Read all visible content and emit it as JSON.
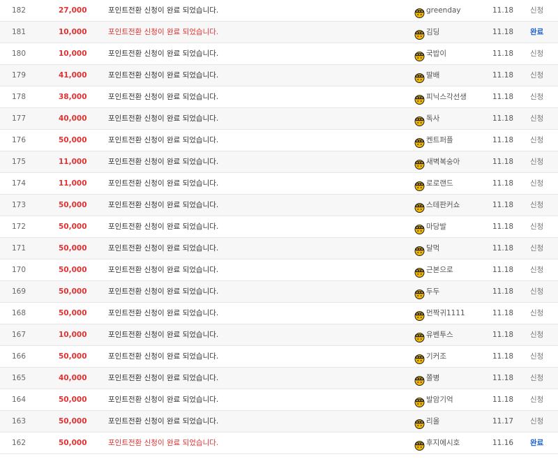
{
  "accent_red": "#e03131",
  "accent_blue": "#1a5fd0",
  "rows": [
    {
      "num": "182",
      "amount": "27,000",
      "subject": "포인트전환 신청이 완료 되었습니다.",
      "user": "greenday",
      "date": "11.18",
      "status": "신청",
      "done": false,
      "avatar_icon": "helmet-avatar-icon"
    },
    {
      "num": "181",
      "amount": "10,000",
      "subject": "포인트전환 신청이 완료 되었습니다.",
      "user": "김딩",
      "date": "11.18",
      "status": "완료",
      "done": true,
      "avatar_icon": "helmet-avatar-icon"
    },
    {
      "num": "180",
      "amount": "10,000",
      "subject": "포인트전환 신청이 완료 되었습니다.",
      "user": "국밥이",
      "date": "11.18",
      "status": "신청",
      "done": false,
      "avatar_icon": "helmet-avatar-icon"
    },
    {
      "num": "179",
      "amount": "41,000",
      "subject": "포인트전환 신청이 완료 되었습니다.",
      "user": "딸배",
      "date": "11.18",
      "status": "신청",
      "done": false,
      "avatar_icon": "helmet-avatar-icon"
    },
    {
      "num": "178",
      "amount": "38,000",
      "subject": "포인트전환 신청이 완료 되었습니다.",
      "user": "피닉스각선생",
      "date": "11.18",
      "status": "신청",
      "done": false,
      "avatar_icon": "helmet-avatar-icon"
    },
    {
      "num": "177",
      "amount": "40,000",
      "subject": "포인트전환 신청이 완료 되었습니다.",
      "user": "독사",
      "date": "11.18",
      "status": "신청",
      "done": false,
      "avatar_icon": "helmet-avatar-icon"
    },
    {
      "num": "176",
      "amount": "50,000",
      "subject": "포인트전환 신청이 완료 되었습니다.",
      "user": "켄트퍼플",
      "date": "11.18",
      "status": "신청",
      "done": false,
      "avatar_icon": "helmet-avatar-icon"
    },
    {
      "num": "175",
      "amount": "11,000",
      "subject": "포인트전환 신청이 완료 되었습니다.",
      "user": "새벽복숭아",
      "date": "11.18",
      "status": "신청",
      "done": false,
      "avatar_icon": "helmet-avatar-icon"
    },
    {
      "num": "174",
      "amount": "11,000",
      "subject": "포인트전환 신청이 완료 되었습니다.",
      "user": "로로랜드",
      "date": "11.18",
      "status": "신청",
      "done": false,
      "avatar_icon": "helmet-avatar-icon"
    },
    {
      "num": "173",
      "amount": "50,000",
      "subject": "포인트전환 신청이 완료 되었습니다.",
      "user": "스테판커쇼",
      "date": "11.18",
      "status": "신청",
      "done": false,
      "avatar_icon": "helmet-avatar-icon"
    },
    {
      "num": "172",
      "amount": "50,000",
      "subject": "포인트전환 신청이 완료 되었습니다.",
      "user": "마당발",
      "date": "11.18",
      "status": "신청",
      "done": false,
      "avatar_icon": "helmet-avatar-icon"
    },
    {
      "num": "171",
      "amount": "50,000",
      "subject": "포인트전환 신청이 완료 되었습니다.",
      "user": "달먹",
      "date": "11.18",
      "status": "신청",
      "done": false,
      "avatar_icon": "helmet-avatar-icon"
    },
    {
      "num": "170",
      "amount": "50,000",
      "subject": "포인트전환 신청이 완료 되었습니다.",
      "user": "근본으로",
      "date": "11.18",
      "status": "신청",
      "done": false,
      "avatar_icon": "helmet-avatar-icon"
    },
    {
      "num": "169",
      "amount": "50,000",
      "subject": "포인트전환 신청이 완료 되었습니다.",
      "user": "두두",
      "date": "11.18",
      "status": "신청",
      "done": false,
      "avatar_icon": "helmet-avatar-icon"
    },
    {
      "num": "168",
      "amount": "50,000",
      "subject": "포인트전환 신청이 완료 되었습니다.",
      "user": "먼짝귀1111",
      "date": "11.18",
      "status": "신청",
      "done": false,
      "avatar_icon": "helmet-avatar-icon"
    },
    {
      "num": "167",
      "amount": "10,000",
      "subject": "포인트전환 신청이 완료 되었습니다.",
      "user": "유벤투스",
      "date": "11.18",
      "status": "신청",
      "done": false,
      "avatar_icon": "helmet-avatar-icon"
    },
    {
      "num": "166",
      "amount": "50,000",
      "subject": "포인트전환 신청이 완료 되었습니다.",
      "user": "기커조",
      "date": "11.18",
      "status": "신청",
      "done": false,
      "avatar_icon": "helmet-avatar-icon"
    },
    {
      "num": "165",
      "amount": "40,000",
      "subject": "포인트전환 신청이 완료 되었습니다.",
      "user": "쫄병",
      "date": "11.18",
      "status": "신청",
      "done": false,
      "avatar_icon": "helmet-avatar-icon"
    },
    {
      "num": "164",
      "amount": "50,000",
      "subject": "포인트전환 신청이 완료 되었습니다.",
      "user": "발암기억",
      "date": "11.18",
      "status": "신청",
      "done": false,
      "avatar_icon": "helmet-avatar-icon"
    },
    {
      "num": "163",
      "amount": "50,000",
      "subject": "포인트전환 신청이 완료 되었습니다.",
      "user": "리올",
      "date": "11.17",
      "status": "신청",
      "done": false,
      "avatar_icon": "helmet-avatar-icon"
    },
    {
      "num": "162",
      "amount": "50,000",
      "subject": "포인트전환 신청이 완료 되었습니다.",
      "user": "후지에시호",
      "date": "11.16",
      "status": "완료",
      "done": true,
      "avatar_icon": "helmet-avatar-icon"
    }
  ]
}
